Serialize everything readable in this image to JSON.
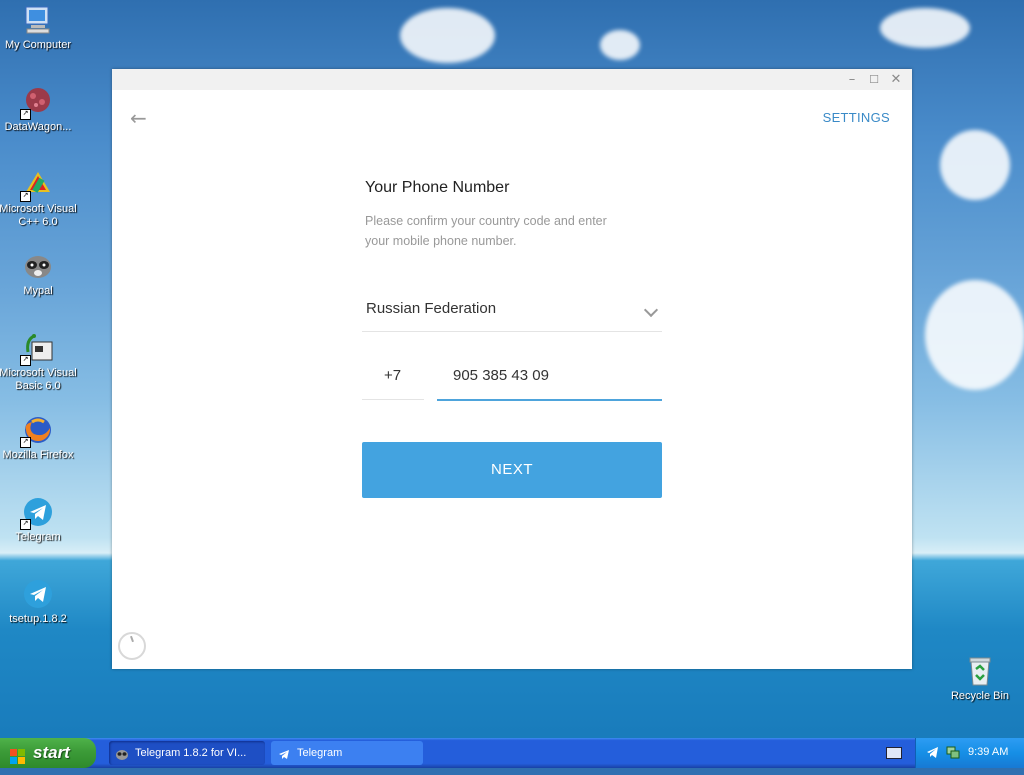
{
  "desktop": {
    "icons": [
      {
        "label": "My Computer"
      },
      {
        "label": "DataWagon..."
      },
      {
        "label": "Microsoft Visual C++ 6.0"
      },
      {
        "label": "Mypal"
      },
      {
        "label": "Microsoft Visual Basic 6.0"
      },
      {
        "label": "Mozilla Firefox"
      },
      {
        "label": "Telegram"
      },
      {
        "label": "tsetup.1.8.2"
      }
    ],
    "recycle_bin": "Recycle Bin"
  },
  "window": {
    "settings_label": "SETTINGS",
    "title": "Your Phone Number",
    "description": "Please confirm your country code and enter your mobile phone number.",
    "country": "Russian Federation",
    "country_code": "+7",
    "phone_number": "905 385 43 09",
    "next_label": "NEXT"
  },
  "taskbar": {
    "start_label": "start",
    "tasks": [
      {
        "label": "Telegram 1.8.2 for VI..."
      },
      {
        "label": "Telegram"
      }
    ],
    "clock": "9:39 AM"
  },
  "colors": {
    "accent": "#43a3e0",
    "link": "#3a8ac7"
  }
}
